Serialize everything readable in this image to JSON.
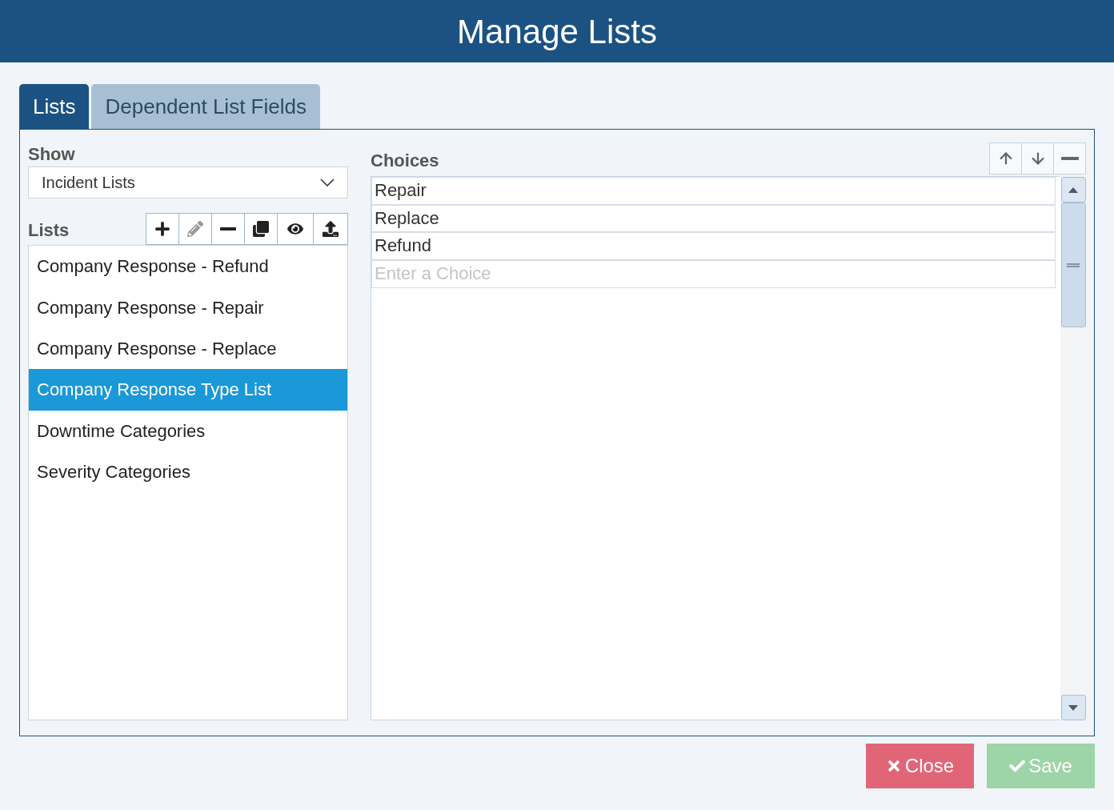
{
  "window": {
    "title": "Manage Lists"
  },
  "tabs": [
    {
      "label": "Lists",
      "selected": true
    },
    {
      "label": "Dependent List Fields",
      "selected": false
    }
  ],
  "show": {
    "label": "Show",
    "value": "Incident Lists"
  },
  "lists": {
    "label": "Lists",
    "tools": [
      {
        "kind": "add",
        "disabled": false
      },
      {
        "kind": "edit",
        "disabled": true
      },
      {
        "kind": "remove",
        "disabled": false
      },
      {
        "kind": "copy",
        "disabled": false
      },
      {
        "kind": "view",
        "disabled": false
      },
      {
        "kind": "upload",
        "disabled": false
      }
    ],
    "items": [
      {
        "label": "Company Response - Refund",
        "selected": false
      },
      {
        "label": "Company Response - Repair",
        "selected": false
      },
      {
        "label": "Company Response - Replace",
        "selected": false
      },
      {
        "label": "Company Response Type List",
        "selected": true
      },
      {
        "label": "Downtime Categories",
        "selected": false
      },
      {
        "label": "Severity Categories",
        "selected": false
      }
    ]
  },
  "choices": {
    "label": "Choices",
    "tools": [
      {
        "kind": "up"
      },
      {
        "kind": "down"
      },
      {
        "kind": "remove"
      }
    ],
    "items": [
      "Repair",
      "Replace",
      "Refund"
    ],
    "placeholder": "Enter a Choice"
  },
  "buttons": [
    {
      "label": "Close",
      "kind": "close",
      "disabled": false
    },
    {
      "label": "Save",
      "kind": "save",
      "disabled": true
    }
  ]
}
